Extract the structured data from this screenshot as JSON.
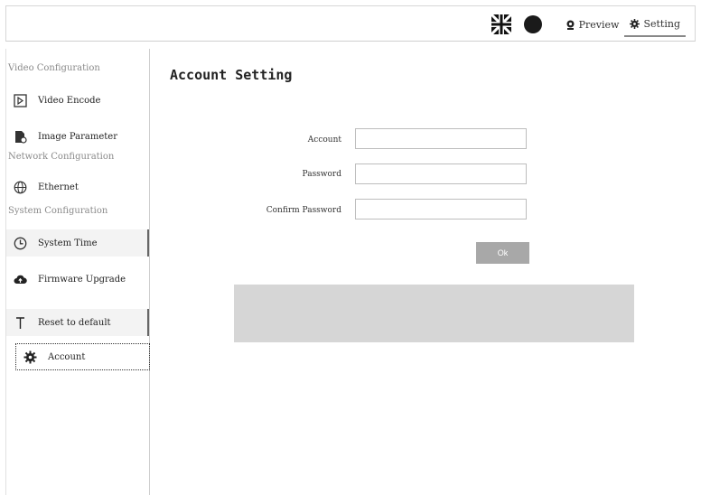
{
  "header": {
    "preview_label": "Preview",
    "setting_label": "Setting"
  },
  "sidebar": {
    "sections": [
      "Video Configuration",
      "Network Configuration",
      "System Configuration"
    ],
    "items": [
      {
        "label": "Video Encode",
        "icon": "video-encode-icon"
      },
      {
        "label": "Image Parameter",
        "icon": "image-parameter-icon"
      },
      {
        "label": "Ethernet",
        "icon": "globe-icon"
      },
      {
        "label": "System Time",
        "icon": "clock-icon"
      },
      {
        "label": "Firmware Upgrade",
        "icon": "cloud-upload-icon"
      },
      {
        "label": "Reset to default",
        "icon": "reset-icon"
      },
      {
        "label": "Account",
        "icon": "gear-icon"
      }
    ]
  },
  "main": {
    "title": "Account Setting",
    "fields": [
      {
        "label": "Account",
        "value": ""
      },
      {
        "label": "Password",
        "value": ""
      },
      {
        "label": "Confirm Password",
        "value": ""
      }
    ],
    "ok_label": "Ok"
  },
  "colors": {
    "button_bg": "#a8a8a8",
    "message_box_bg": "#d6d6d6",
    "active_item_bg": "#f3f3f3"
  }
}
